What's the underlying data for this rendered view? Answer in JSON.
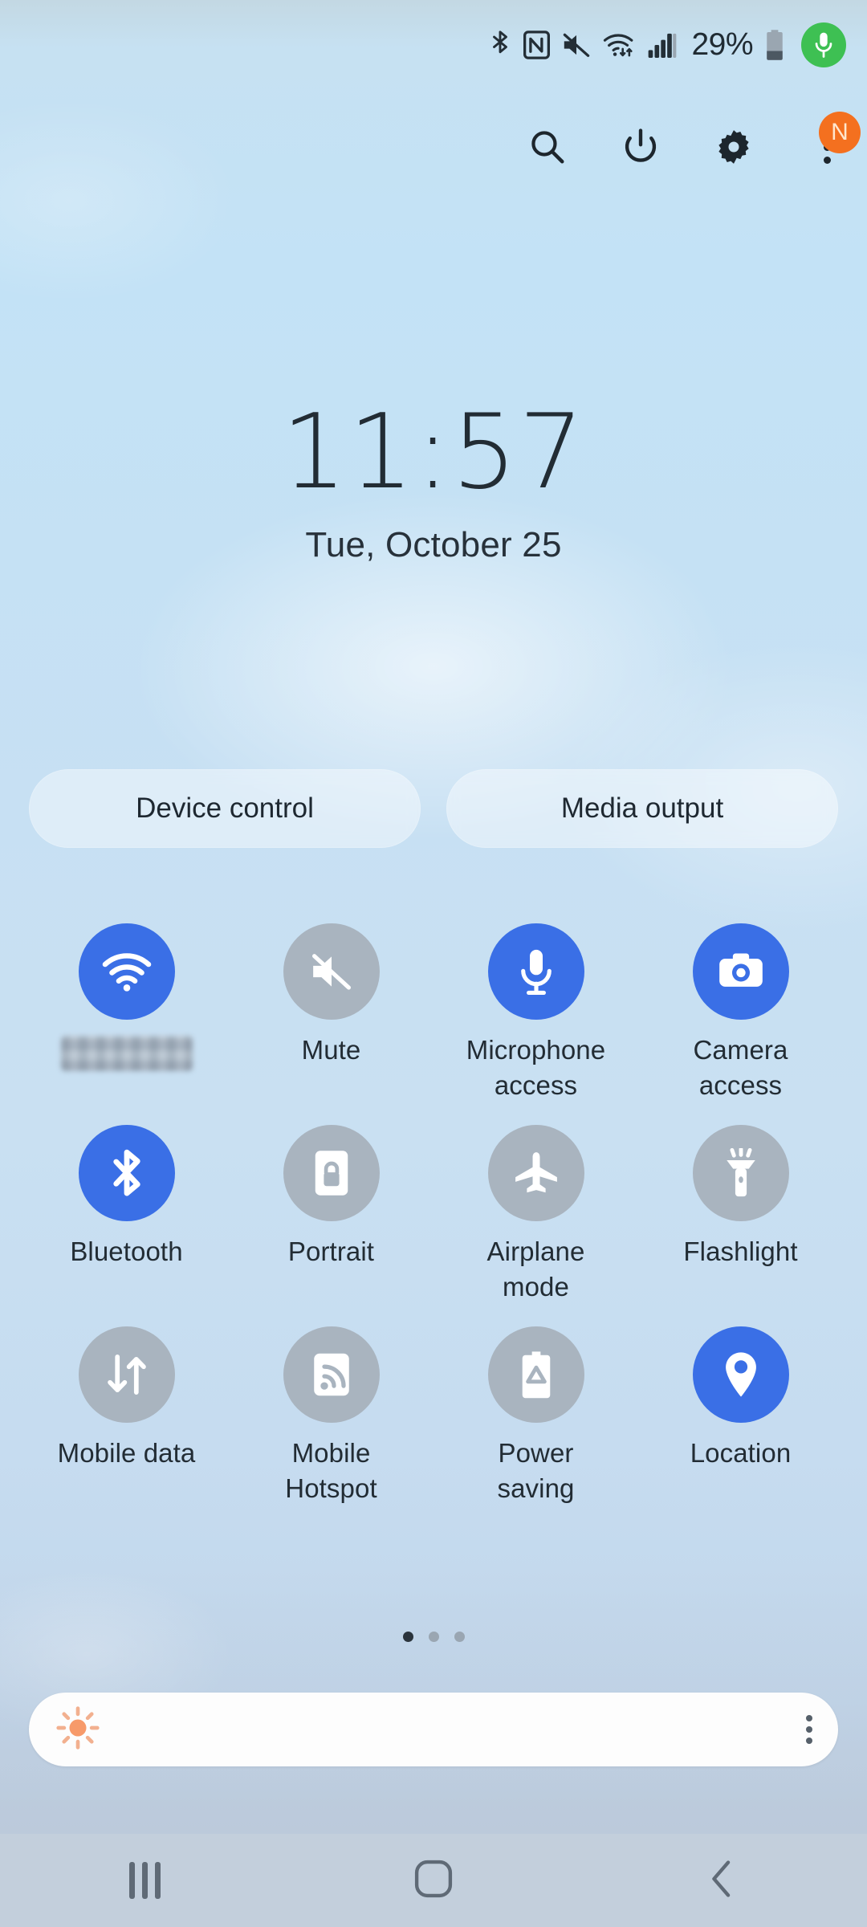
{
  "status_bar": {
    "icons": [
      "bluetooth-icon",
      "nfc-icon",
      "mute-icon",
      "wifi-icon",
      "signal-icon"
    ],
    "battery_percent": "29%",
    "battery_icon": "battery-icon",
    "mic_indicator": "microphone-active-indicator"
  },
  "header": {
    "search_label": "search-icon",
    "power_label": "power-icon",
    "settings_label": "gear-icon",
    "more_label": "more-options-icon",
    "badge_text": "N"
  },
  "clock": {
    "time": "11:57",
    "date": "Tue, October 25"
  },
  "pills": [
    {
      "label": "Device control",
      "name": "device-control-pill"
    },
    {
      "label": "Media output",
      "name": "media-output-pill"
    }
  ],
  "tiles": [
    {
      "label": "",
      "icon": "wifi-icon",
      "state": "on",
      "name": "tile-wifi",
      "blurred": true
    },
    {
      "label": "Mute",
      "icon": "mute-icon",
      "state": "off",
      "name": "tile-mute"
    },
    {
      "label": "Microphone access",
      "icon": "microphone-icon",
      "state": "on",
      "name": "tile-microphone-access"
    },
    {
      "label": "Camera access",
      "icon": "camera-icon",
      "state": "on",
      "name": "tile-camera-access"
    },
    {
      "label": "Bluetooth",
      "icon": "bluetooth-icon",
      "state": "on",
      "name": "tile-bluetooth"
    },
    {
      "label": "Portrait",
      "icon": "rotation-lock-icon",
      "state": "off",
      "name": "tile-portrait"
    },
    {
      "label": "Airplane mode",
      "icon": "airplane-icon",
      "state": "off",
      "name": "tile-airplane-mode"
    },
    {
      "label": "Flashlight",
      "icon": "flashlight-icon",
      "state": "off",
      "name": "tile-flashlight"
    },
    {
      "label": "Mobile data",
      "icon": "mobile-data-icon",
      "state": "off",
      "name": "tile-mobile-data"
    },
    {
      "label": "Mobile Hotspot",
      "icon": "hotspot-icon",
      "state": "off",
      "name": "tile-mobile-hotspot"
    },
    {
      "label": "Power saving",
      "icon": "power-saving-icon",
      "state": "off",
      "name": "tile-power-saving"
    },
    {
      "label": "Location",
      "icon": "location-pin-icon",
      "state": "on",
      "name": "tile-location"
    }
  ],
  "pager": {
    "count": 3,
    "active_index": 0
  },
  "brightness": {
    "icon": "brightness-sun-icon",
    "value_percent": 3,
    "more_label": "brightness-options-icon"
  },
  "nav_bar": {
    "recents_label": "recents-icon",
    "home_label": "home-icon",
    "back_label": "back-icon"
  },
  "colors": {
    "accent_blue": "#3a6fe6",
    "tile_off_gray": "#a9b4bf",
    "badge_orange": "#f4701f",
    "mic_green": "#3ec053",
    "sun_orange": "#f79a6a"
  }
}
